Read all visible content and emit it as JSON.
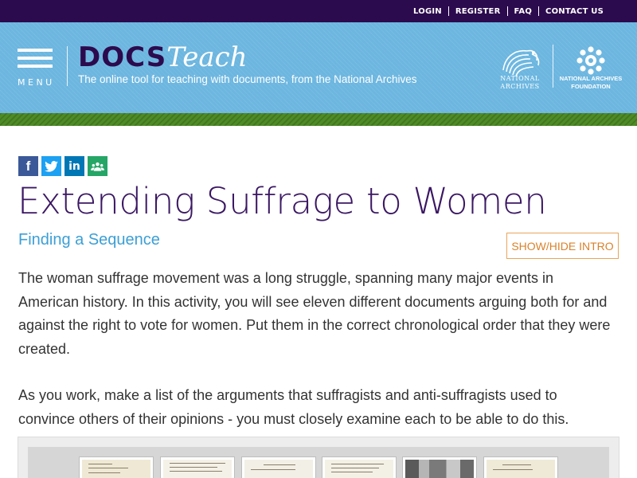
{
  "topnav": {
    "links": [
      "LOGIN",
      "REGISTER",
      "FAQ",
      "CONTACT US"
    ]
  },
  "header": {
    "menu_label": "MENU",
    "logo_docs": "DOCS",
    "logo_teach": "Teach",
    "tagline": "The online tool for teaching with documents, from the National Archives",
    "na_logo_text": "NATIONAL ARCHIVES",
    "naf_logo_text": "NATIONAL ARCHIVES FOUNDATION"
  },
  "social": [
    "facebook-icon",
    "twitter-icon",
    "linkedin-icon",
    "google-classroom-icon"
  ],
  "colors": {
    "topbar": "#2c0a4e",
    "header_blue": "#6cb6e0",
    "stripe_green": "#4e8c26",
    "title": "#3b1763",
    "subtitle": "#3c9fd6",
    "accent_orange": "#d9822b",
    "facebook": "#3b5998",
    "twitter": "#1da1f2",
    "linkedin": "#0077b5",
    "classroom": "#25a667"
  },
  "page": {
    "title": "Extending Suffrage to Women",
    "subtitle": "Finding a Sequence",
    "toggle_label": "SHOW/HIDE INTRO",
    "intro_p1": "The woman suffrage movement was a long struggle, spanning many major events in American history. In this activity, you will see eleven different documents arguing both for and against the right to vote for women. Put them in the correct chronological order that they were created.",
    "intro_p2": "As you work, make a list of the arguments that suffragists and anti-suffragists used to convince others of their opinions - you must closely examine each to be able to do this."
  },
  "documents": [
    "document-thumbnail",
    "document-thumbnail",
    "document-thumbnail",
    "document-thumbnail",
    "photo-thumbnail",
    "document-thumbnail"
  ]
}
